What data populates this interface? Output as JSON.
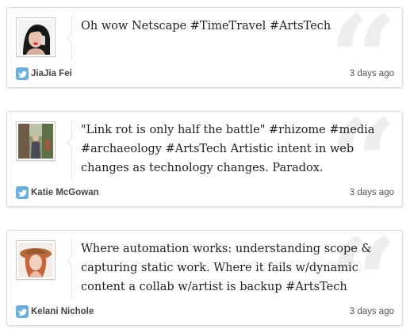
{
  "tweets": [
    {
      "text": "Oh wow Netscape #TimeTravel #ArtsTech",
      "author": "JiaJia Fei",
      "time": "3 days ago"
    },
    {
      "text": "\"Link rot is only half the battle\" #rhizome #media #archaeology #ArtsTech Artistic intent in web changes as technology changes. Paradox.",
      "author": "Katie McGowan",
      "time": "3 days ago"
    },
    {
      "text": "Where automation works: understanding scope & capturing static work. Where it fails w/dynamic content a collab w/artist is backup #ArtsTech",
      "author": "Kelani Nichole",
      "time": "3 days ago"
    }
  ],
  "quote_glyph": "“",
  "icons": {
    "source": "twitter-bird-icon",
    "decoration": "quote-mark-icon"
  },
  "colors": {
    "twitter_blue": "#6aafdc",
    "card_border": "#d9d9d9",
    "quote_mark": "#eeeeee",
    "text": "#222222"
  }
}
